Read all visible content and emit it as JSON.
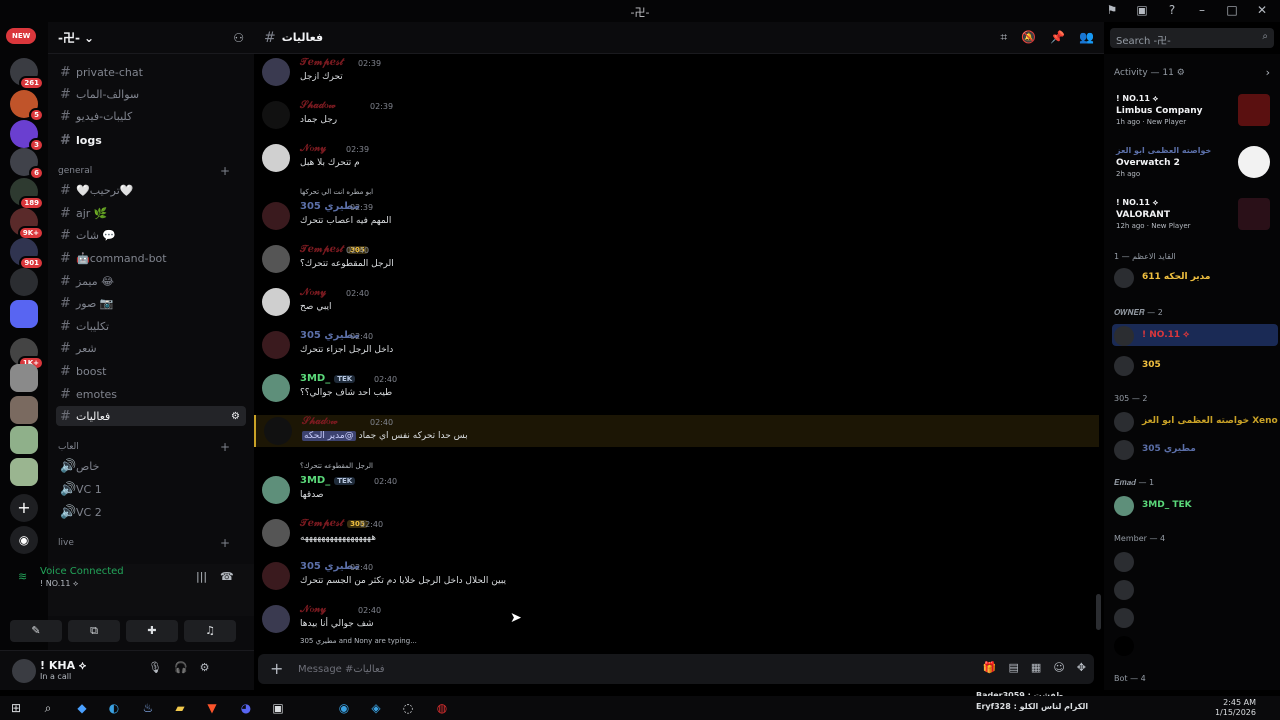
{
  "window": {
    "title": "-卍-"
  },
  "guild": {
    "name": "-卍-"
  },
  "servers": {
    "new_label": "NEW",
    "badges": [
      "261",
      "5",
      "3",
      "6",
      "189",
      "9K+",
      "901",
      "1K+"
    ]
  },
  "sidebar": {
    "channels_top": [
      "private-chat",
      "سوالف-الماب",
      "كليبات-فيديو",
      "logs"
    ],
    "category_general": "general",
    "channels_general": [
      "🤍ترحيب🤍",
      "ajr 🌿",
      "شات 💬",
      "🤖command-bot",
      "ميمز 😂",
      "صور 📷",
      "تكليبات",
      "شعر",
      "boost",
      "emotes",
      "فعاليات"
    ],
    "category_voice": "العاب",
    "voice_channels": [
      "خاص",
      "VC 1",
      "VC 2"
    ],
    "category_live": "live"
  },
  "voice": {
    "status": "Voice Connected",
    "channel": "! NO.11 ⟡"
  },
  "user": {
    "name": "! KHA ⟡",
    "status": "In a call"
  },
  "channel": {
    "name": "فعاليات",
    "placeholder": "Message #فعاليات"
  },
  "search": {
    "placeholder": "Search -卍-"
  },
  "messages": [
    {
      "author": "𝒯ℯ𝓂𝓅ℯ𝓈𝓉",
      "tag": "",
      "time": "02:39",
      "body": "تحرك ازجل",
      "color": "red"
    },
    {
      "author": "𝒮𝒽𝒶𝒹ℴ𝓌",
      "tag": "",
      "time": "02:39",
      "body": "رجل جماد",
      "color": "red"
    },
    {
      "author": "𝒩ℴ𝓃𝓎",
      "tag": "",
      "time": "02:39",
      "body": "م تتحرك بلا هبل",
      "color": "red"
    },
    {
      "author": "مطيري 305",
      "tag": "",
      "time": "02:39",
      "body": "المهم فيه اعصاب تتحرك",
      "color": "blue",
      "reply": "ابو مطره انت الي تحركها"
    },
    {
      "author": "𝒯ℯ𝓂𝓅ℯ𝓈𝓉",
      "tag": "305",
      "time": "02:40",
      "body": "الرجل المقطوعه تتحرك؟",
      "color": "red"
    },
    {
      "author": "𝒩ℴ𝓃𝓎",
      "tag": "",
      "time": "02:40",
      "body": "ايبي صح",
      "color": "red"
    },
    {
      "author": "مطيري 305",
      "tag": "",
      "time": "02:40",
      "body": "داخل الرجل اجزاء تتحرك",
      "color": "blue"
    },
    {
      "author": "3MD_",
      "tag": "TEK",
      "time": "02:40",
      "body": "طيب احد شاف جوالي؟؟",
      "color": "green"
    },
    {
      "author": "𝒮𝒽𝒶𝒹ℴ𝓌",
      "tag": "",
      "time": "02:40",
      "body": "بس حدا تحركه نفس اي جماد",
      "mention": "@مدير الحكه",
      "color": "red",
      "highlight": true
    },
    {
      "author": "3MD_",
      "tag": "TEK",
      "time": "02:40",
      "body": "صدقها",
      "color": "green",
      "reply": "الرجل المقطوعه تتحرك؟"
    },
    {
      "author": "𝒯ℯ𝓂𝓅ℯ𝓈𝓉",
      "tag": "305",
      "time": "02:40",
      "body": "هههههههههههههههههه",
      "color": "red"
    },
    {
      "author": "مطيري 305",
      "tag": "",
      "time": "02:40",
      "body": "يبين الحلال داخل الرجل خلايا دم تكثر من الجسم تتحرك",
      "color": "blue"
    },
    {
      "author": "𝒩ℴ𝓃𝓎",
      "tag": "",
      "time": "02:40",
      "body": "شف جوالي أنا بيدها",
      "color": "red"
    }
  ],
  "typing": "305 مطيري and Nony are typing...",
  "activity": {
    "title": "Activity — 11 ⚙",
    "cards": [
      {
        "who": "! NO.11 ⟡",
        "game": "Limbus Company",
        "ago": "1h ago · New Player"
      },
      {
        "who": "خواصته العظمى ابو العز",
        "game": "Overwatch 2",
        "ago": "2h ago"
      },
      {
        "who": "! NO.11 ⟡",
        "game": "VALORANT",
        "ago": "12h ago · New Player"
      }
    ],
    "groups": [
      {
        "label": "القايد الاعظم — 1",
        "members": [
          "مدير الحكه 611"
        ]
      },
      {
        "label": "𝑶𝑾𝑵𝑬𝑹 — 2",
        "members": [
          "! NO.11 ⟡",
          "305"
        ]
      },
      {
        "label": "305 — 2",
        "members": [
          "خواصته العظمى ابو العز Xeno",
          "مطيري 305"
        ]
      },
      {
        "label": "𝑬𝒎𝒂𝒅 — 1",
        "members": [
          "3MD_ TEK"
        ]
      },
      {
        "label": "Member — 4",
        "members": [
          "",
          "",
          "",
          ""
        ]
      },
      {
        "label": "Bot — 4",
        "members": []
      }
    ]
  },
  "taskbar": {
    "time": "2:45 AM",
    "date": "1/15/2026",
    "notif1": "Bader3059 : طفشت",
    "notif2": "Eryf328 : الكرام لناس الكلو"
  }
}
